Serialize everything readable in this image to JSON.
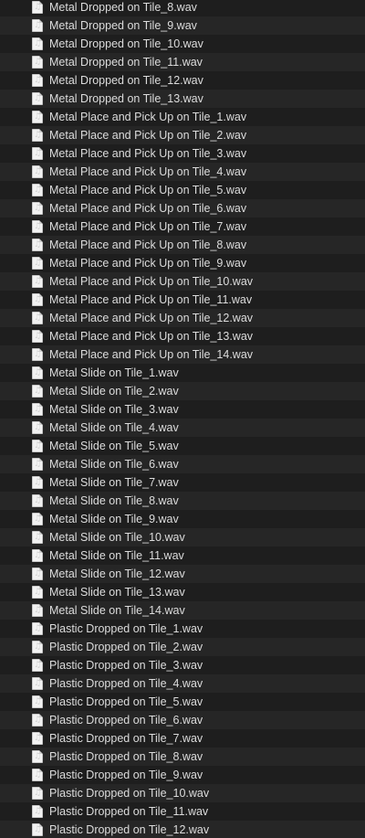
{
  "icon": "audio-file-icon",
  "colors": {
    "background": "#1e1e1e",
    "row_alt": "#262626",
    "text": "#dcdcdc"
  },
  "files": [
    "Metal Dropped on Tile_8.wav",
    "Metal Dropped on Tile_9.wav",
    "Metal Dropped on Tile_10.wav",
    "Metal Dropped on Tile_11.wav",
    "Metal Dropped on Tile_12.wav",
    "Metal Dropped on Tile_13.wav",
    "Metal Place and Pick Up on Tile_1.wav",
    "Metal Place and Pick Up on Tile_2.wav",
    "Metal Place and Pick Up on Tile_3.wav",
    "Metal Place and Pick Up on Tile_4.wav",
    "Metal Place and Pick Up on Tile_5.wav",
    "Metal Place and Pick Up on Tile_6.wav",
    "Metal Place and Pick Up on Tile_7.wav",
    "Metal Place and Pick Up on Tile_8.wav",
    "Metal Place and Pick Up on Tile_9.wav",
    "Metal Place and Pick Up on Tile_10.wav",
    "Metal Place and Pick Up on Tile_11.wav",
    "Metal Place and Pick Up on Tile_12.wav",
    "Metal Place and Pick Up on Tile_13.wav",
    "Metal Place and Pick Up on Tile_14.wav",
    "Metal Slide on Tile_1.wav",
    "Metal Slide on Tile_2.wav",
    "Metal Slide on Tile_3.wav",
    "Metal Slide on Tile_4.wav",
    "Metal Slide on Tile_5.wav",
    "Metal Slide on Tile_6.wav",
    "Metal Slide on Tile_7.wav",
    "Metal Slide on Tile_8.wav",
    "Metal Slide on Tile_9.wav",
    "Metal Slide on Tile_10.wav",
    "Metal Slide on Tile_11.wav",
    "Metal Slide on Tile_12.wav",
    "Metal Slide on Tile_13.wav",
    "Metal Slide on Tile_14.wav",
    "Plastic Dropped on Tile_1.wav",
    "Plastic Dropped on Tile_2.wav",
    "Plastic Dropped on Tile_3.wav",
    "Plastic Dropped on Tile_4.wav",
    "Plastic Dropped on Tile_5.wav",
    "Plastic Dropped on Tile_6.wav",
    "Plastic Dropped on Tile_7.wav",
    "Plastic Dropped on Tile_8.wav",
    "Plastic Dropped on Tile_9.wav",
    "Plastic Dropped on Tile_10.wav",
    "Plastic Dropped on Tile_11.wav",
    "Plastic Dropped on Tile_12.wav"
  ]
}
